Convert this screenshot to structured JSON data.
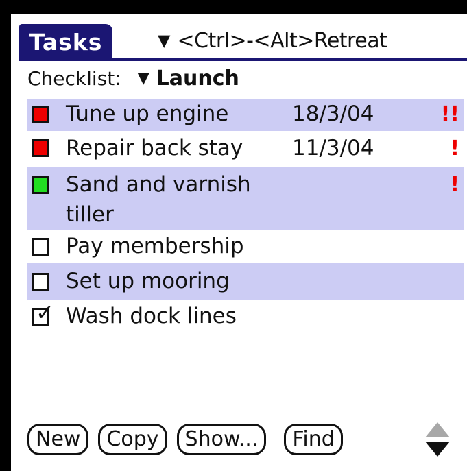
{
  "app": {
    "title": "Tasks",
    "category": "<Ctrl>-<Alt>Retreat"
  },
  "checklist": {
    "label": "Checklist:",
    "value": "Launch"
  },
  "tasks": [
    {
      "line1": "Tune up engine",
      "line2": "",
      "due": "18/3/04",
      "priority": "!!",
      "status": "red",
      "highlighted": true
    },
    {
      "line1": "Repair back stay",
      "line2": "",
      "due": "11/3/04",
      "priority": "!",
      "status": "red",
      "highlighted": false
    },
    {
      "line1": "Sand and varnish",
      "line2": "tiller",
      "due": "",
      "priority": "!",
      "status": "green",
      "highlighted": true
    },
    {
      "line1": "Pay membership",
      "line2": "",
      "due": "",
      "priority": "",
      "status": "empty",
      "highlighted": false
    },
    {
      "line1": "Set up mooring",
      "line2": "",
      "due": "",
      "priority": "",
      "status": "empty",
      "highlighted": true
    },
    {
      "line1": "Wash dock lines",
      "line2": "",
      "due": "",
      "priority": "",
      "status": "done",
      "highlighted": false
    }
  ],
  "buttons": {
    "new": "New",
    "copy": "Copy",
    "show": "Show...",
    "find": "Find"
  },
  "colors": {
    "title_bg": "#1b1673",
    "row_highlight": "#ccccf4",
    "status_red": "#ee0000",
    "status_green": "#22dd22",
    "priority": "#ee0000"
  },
  "icons": {
    "category_dropdown": "triangle-down",
    "checklist_dropdown": "triangle-down",
    "scroll": "up-down-arrows"
  }
}
